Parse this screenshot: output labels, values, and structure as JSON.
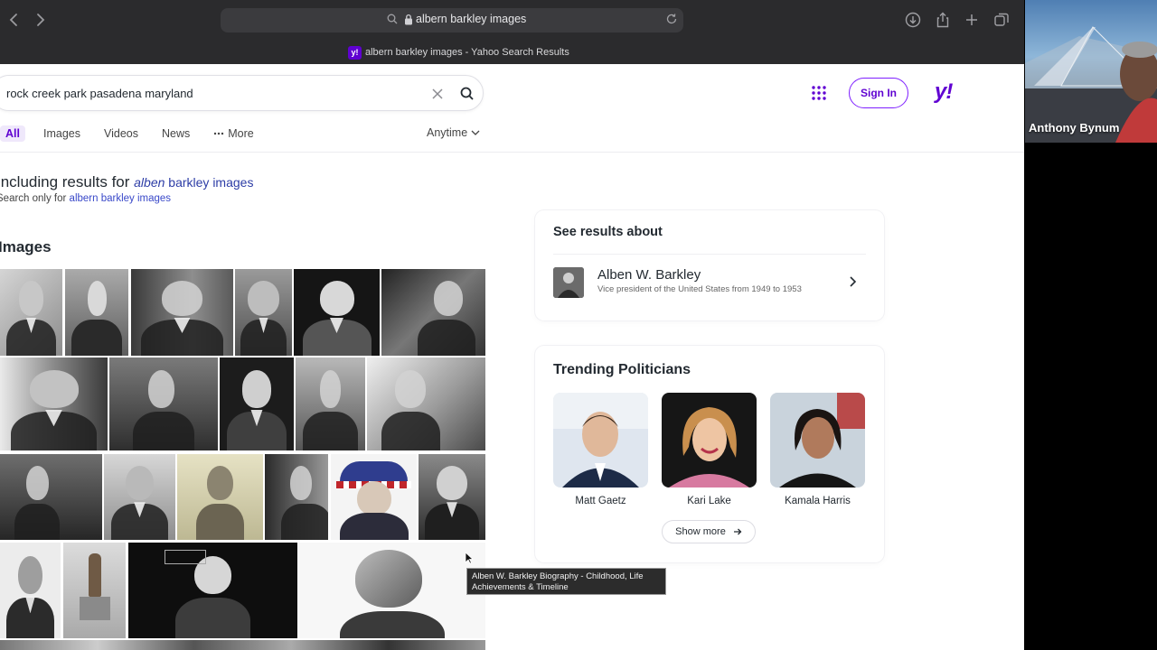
{
  "browser": {
    "address_text": "albern barkley images",
    "tab_title": "albern barkley images - Yahoo Search Results",
    "favicon_label": "y!"
  },
  "search": {
    "query": "rock creek park pasadena maryland"
  },
  "header": {
    "signin_label": "Sign In",
    "logo_text": "y!",
    "brand_color": "#6001d2"
  },
  "tabs": [
    {
      "label": "All",
      "active": true
    },
    {
      "label": "Images"
    },
    {
      "label": "Videos"
    },
    {
      "label": "News"
    },
    {
      "label": "More"
    }
  ],
  "filter": {
    "anytime_label": "Anytime"
  },
  "correction": {
    "prefix": "Including results for ",
    "corrected_italic": "alben",
    "corrected_rest": " barkley images",
    "search_only_prefix": "Search only for ",
    "search_only_link": "albern barkley images"
  },
  "images": {
    "heading": "Images"
  },
  "tooltip": {
    "text": "Alben W. Barkley Biography - Childhood, Life Achievements & Timeline"
  },
  "about": {
    "title": "See results about",
    "name": "Alben W. Barkley",
    "description": "Vice president of the United States from 1949 to 1953"
  },
  "trending": {
    "title": "Trending Politicians",
    "people": [
      {
        "name": "Matt Gaetz"
      },
      {
        "name": "Kari Lake"
      },
      {
        "name": "Kamala Harris"
      }
    ],
    "show_more_label": "Show more"
  },
  "video": {
    "participant_name": "Anthony Bynum"
  }
}
